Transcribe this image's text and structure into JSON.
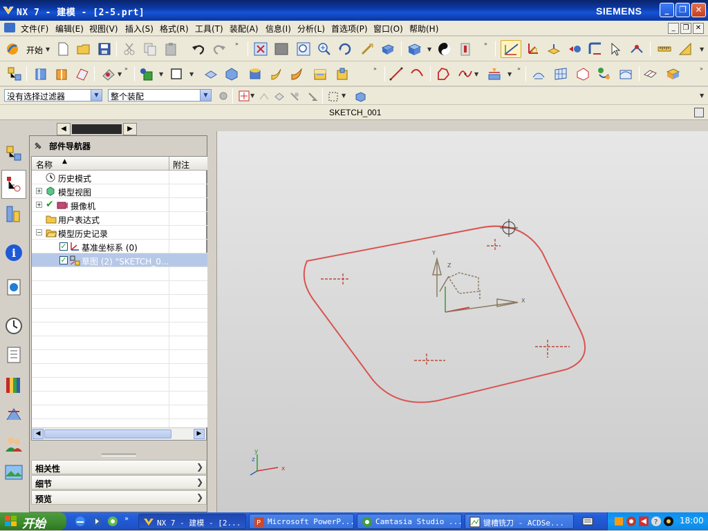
{
  "window": {
    "title": "NX 7 - 建模 - [2-5.prt]",
    "brand": "SIEMENS"
  },
  "menu": [
    "文件(F)",
    "编辑(E)",
    "视图(V)",
    "插入(S)",
    "格式(R)",
    "工具(T)",
    "装配(A)",
    "信息(I)",
    "分析(L)",
    "首选项(P)",
    "窗口(O)",
    "帮助(H)"
  ],
  "toolbar": {
    "start_label": "开始"
  },
  "filters": {
    "selection_filter": "没有选择过滤器",
    "assembly_scope": "整个装配"
  },
  "sketch_title": "SKETCH_001",
  "navigator": {
    "title": "部件导航器",
    "columns": {
      "name": "名称",
      "note": "附注"
    },
    "items": [
      {
        "label": "历史模式"
      },
      {
        "label": "模型视图"
      },
      {
        "label": "摄像机"
      },
      {
        "label": "用户表达式"
      },
      {
        "label": "模型历史记录"
      },
      {
        "label": "基准坐标系 (0)"
      },
      {
        "label": "草图 (2) \"SKETCH_0..."
      }
    ],
    "panels": [
      "相关性",
      "细节",
      "预览"
    ]
  },
  "viewport": {
    "axes": {
      "x": "X",
      "y": "Y",
      "z": "Z"
    },
    "triad": {
      "x": "x",
      "y": "y",
      "z": "z"
    },
    "sketch_color": "#d9534f"
  },
  "taskbar": {
    "start": "开始",
    "tasks": [
      "NX 7 - 建模 - [2...",
      "Microsoft PowerP...",
      "Camtasia Studio ...",
      "键槽铣刀 - ACDSe..."
    ],
    "clock": "18:00"
  },
  "colors": {
    "titlebar": "#0c3aa8",
    "taskbar": "#245edb",
    "start_button": "#3b8a2e",
    "selection": "#b6c8e8"
  }
}
